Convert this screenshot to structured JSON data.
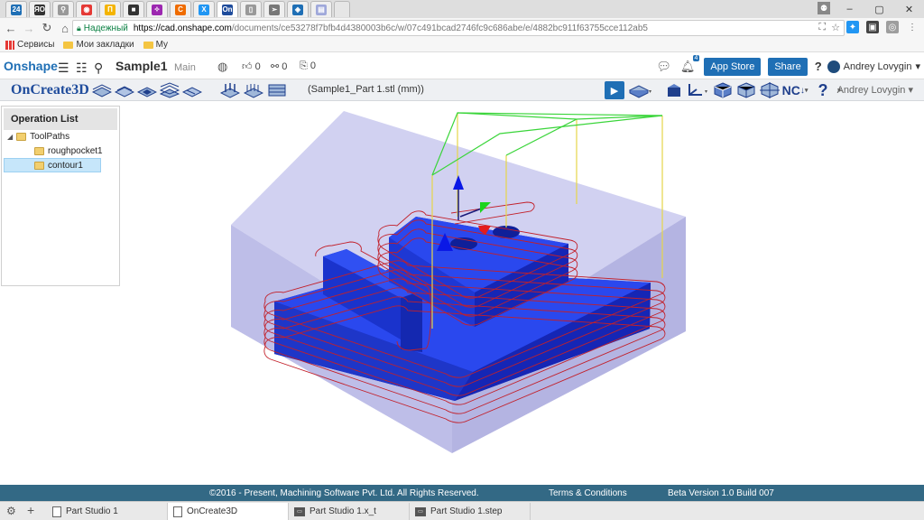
{
  "browser": {
    "tabs": [
      {
        "label": "24",
        "color": "#1f6fb5"
      },
      {
        "label": "ЯО",
        "color": "#333"
      },
      {
        "label": "⚲",
        "color": "#999"
      },
      {
        "label": "◉",
        "color": "#e53935"
      },
      {
        "label": "П",
        "color": "#f4b400"
      },
      {
        "label": "■",
        "color": "#333"
      },
      {
        "label": "✧",
        "color": "#9c27b0"
      },
      {
        "label": "C",
        "color": "#ef6c00"
      },
      {
        "label": "X",
        "color": "#2196f3"
      },
      {
        "label": "On",
        "color": "#1f4c9c"
      },
      {
        "label": "▯",
        "color": "#999"
      },
      {
        "label": "➢",
        "color": "#777"
      },
      {
        "label": "◈",
        "color": "#1f6fb5"
      },
      {
        "label": "▤",
        "color": "#9fa8da"
      }
    ],
    "window_controls": [
      "–",
      "▢",
      "✕"
    ],
    "security_label": "Надежный",
    "url_host": "https://cad.onshape.com",
    "url_path": "/documents/ce53278f7bfb4d4380003b6c/w/07c491bcad2746fc9c686abe/e/4882bc911f63755cce112ab5",
    "bookmarks": [
      "Сервисы",
      "Мои закладки",
      "My"
    ]
  },
  "onshape": {
    "logo": "Onshape",
    "document": "Sample1",
    "workspace": "Main",
    "likes": "0",
    "links": "0",
    "copies": "0",
    "notifications": "4",
    "app_store_label": "App Store",
    "share_label": "Share",
    "help_label": "?",
    "user": "Andrey Lovygin"
  },
  "oncreate": {
    "logo": "OnCreate3D",
    "file": "(Sample1_Part 1.stl (mm))",
    "user": "Andrey Lovygin",
    "nc_label": "NC"
  },
  "operation_list": {
    "title": "Operation List",
    "root": "ToolPaths",
    "items": [
      "roughpocket1",
      "contour1"
    ],
    "selected": "contour1"
  },
  "footer": {
    "copyright": "©2016 - Present, Machining Software Pvt. Ltd. All Rights Reserved.",
    "terms": "Terms & Conditions",
    "version": "Beta Version 1.0 Build 007"
  },
  "bottom_tabs": [
    {
      "label": "Part Studio 1",
      "icon": "part-studio-icon"
    },
    {
      "label": "OnCreate3D",
      "icon": "document-icon"
    },
    {
      "label": "Part Studio 1.x_t",
      "icon": "stl-file-icon"
    },
    {
      "label": "Part Studio 1.step",
      "icon": "stl-file-icon"
    }
  ],
  "colors": {
    "brand": "#1f6fb5",
    "footer": "#336985",
    "part": "#1f3fd6",
    "stock": "#b8b8e8",
    "toolpath": "#c2202a"
  }
}
